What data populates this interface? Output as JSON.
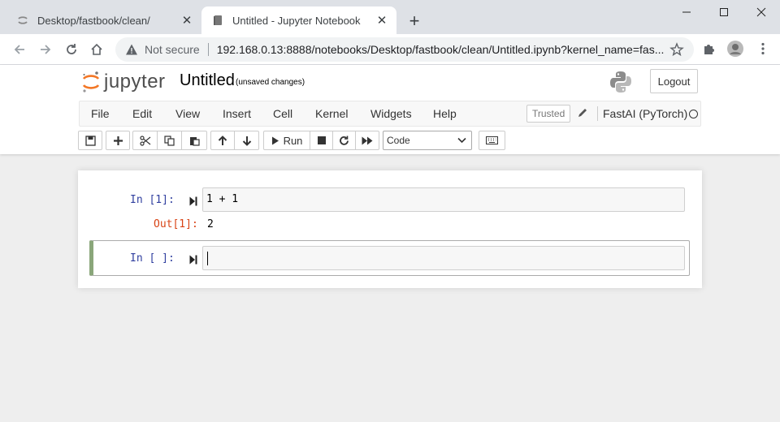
{
  "browser": {
    "tabs": [
      {
        "title": "Desktop/fastbook/clean/",
        "active": false
      },
      {
        "title": "Untitled - Jupyter Notebook",
        "active": true
      }
    ],
    "security_label": "Not secure",
    "url": "192.168.0.13:8888/notebooks/Desktop/fastbook/clean/Untitled.ipynb?kernel_name=fas..."
  },
  "jupyter": {
    "logo_text": "jupyter",
    "notebook_title": "Untitled",
    "save_status": "(unsaved changes)",
    "logout_label": "Logout",
    "menu": [
      "File",
      "Edit",
      "View",
      "Insert",
      "Cell",
      "Kernel",
      "Widgets",
      "Help"
    ],
    "trusted_label": "Trusted",
    "kernel_name": "FastAI (PyTorch)",
    "run_label": "Run",
    "cell_type": "Code"
  },
  "cells": [
    {
      "prompt": "In [1]:",
      "source": "1 + 1",
      "out_prompt": "Out[1]:",
      "output": "2"
    },
    {
      "prompt": "In [ ]:",
      "source": ""
    }
  ],
  "colors": {
    "in_prompt": "#303f9f",
    "out_prompt": "#d84315",
    "selected_cell_edge": "#8aa67a",
    "jupyter_orange": "#f37726"
  }
}
